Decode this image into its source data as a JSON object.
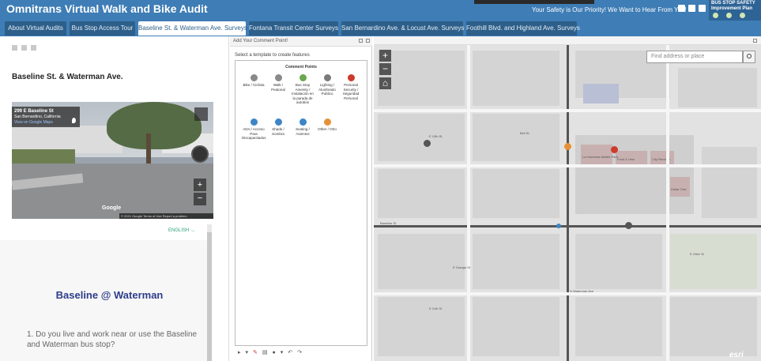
{
  "header": {
    "title": "Omnitrans Virtual Walk and Bike Audit",
    "tagline": "Your Safety is Our Priority! We Want to Hear From You!",
    "logo_text_1": "BUS STOP SAFETY",
    "logo_text_2": "Improvement Plan",
    "social_icons": [
      "facebook-icon",
      "twitter-icon",
      "link-icon"
    ]
  },
  "tabs": [
    {
      "label": "About Virtual Audits"
    },
    {
      "label": "Bus Stop Access Tour"
    },
    {
      "label": "Baseline St. & Waterman Ave. Surveys"
    },
    {
      "label": "Fontana Transit Center Surveys"
    },
    {
      "label": "San Bernardino Ave. & Locust Ave. Surveys"
    },
    {
      "label": "Foothill Blvd. and Highland Ave. Surveys"
    }
  ],
  "active_tab": "Baseline St. & Waterman Ave. Surveys",
  "left": {
    "section_title": "Baseline St. & Waterman Ave.",
    "streetview": {
      "address": "299 E Baseline St",
      "city": "San Bernardino, California",
      "view_link": "View on Google Maps",
      "google": "Google",
      "footer": "© 2021 Google   Terms of Use   Report a problem"
    },
    "language_link": "ENGLISH →",
    "survey_heading": "Baseline @ Waterman",
    "question_1": "1. Do you live and work near or use the Baseline and Waterman bus stop?"
  },
  "editor": {
    "header": "Add Your Comment Point!",
    "select_template": "Select a template to create features",
    "group_title": "Comment Points",
    "templates": [
      {
        "label": "Bike / Ciclista",
        "color": "#8a8a8a"
      },
      {
        "label": "Walk / Peatonal",
        "color": "#8a8a8a"
      },
      {
        "label": "Bus Stop Amenity / Instalación en la parada de autobús",
        "color": "#6aa84f"
      },
      {
        "label": "Lighting / Alumbrado Publico",
        "color": "#7a7a7a"
      },
      {
        "label": "Personal Security / Seguridad Personal",
        "color": "#cc3b2b"
      },
      {
        "label": "ADA / Acceso Para Discapacitados",
        "color": "#3d85c6"
      },
      {
        "label": "Shade / Sombra",
        "color": "#3d85c6"
      },
      {
        "label": "Seating / Asientos",
        "color": "#3d85c6"
      },
      {
        "label": "Other / Otro",
        "color": "#e69138"
      }
    ],
    "toolbar_icons": [
      "select-icon",
      "dropdown-icon",
      "delete-icon",
      "attributes-icon",
      "point-icon",
      "dropdown-icon",
      "undo-icon",
      "redo-icon"
    ]
  },
  "map": {
    "search_placeholder": "Find address or place",
    "zoom_in": "+",
    "zoom_out": "−",
    "esri_logo": "esri",
    "street_labels": [
      "E 13th St",
      "Baseline St",
      "E Olive St",
      "E Orange St",
      "E 11th St",
      "N Waterman Ave",
      "Bell St"
    ],
    "poi_labels": [
      "La Hacienda Mobile Park",
      "Food 4 Less",
      "City Records",
      "Dollar Tree"
    ]
  }
}
